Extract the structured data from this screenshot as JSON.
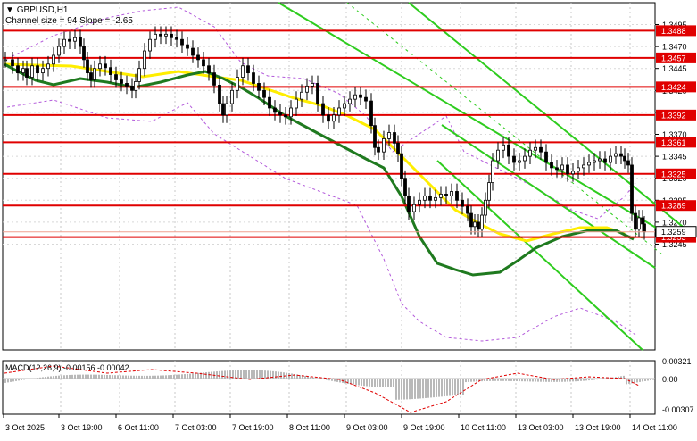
{
  "header": {
    "symbol": "GBPUSD,H1",
    "channel": "Channel size = 94 Slope = -2.65"
  },
  "price_axis": {
    "ticks": [
      "1.3495",
      "1.3470",
      "1.3445",
      "1.3420",
      "1.3395",
      "1.3370",
      "1.3345",
      "1.3320",
      "1.3295",
      "1.3270",
      "1.3245"
    ]
  },
  "levels": [
    {
      "label": "1.3488",
      "price": 1.3488
    },
    {
      "label": "1.3457",
      "price": 1.3457
    },
    {
      "label": "1.3424",
      "price": 1.3424
    },
    {
      "label": "1.3392",
      "price": 1.3392
    },
    {
      "label": "1.3361",
      "price": 1.3361
    },
    {
      "label": "1.3325",
      "price": 1.3325
    },
    {
      "label": "1.3289",
      "price": 1.3289
    },
    {
      "label": "1.3253",
      "price": 1.3253
    }
  ],
  "current_price": {
    "label": "1.3259",
    "price": 1.3259
  },
  "macd": {
    "title": "MACD(12,26,9) -0.00156 -0.00042",
    "ticks": [
      "0.00321",
      "0.00",
      "-0.00307"
    ]
  },
  "time_axis": {
    "labels": [
      "3 Oct 2025",
      "3 Oct 19:00",
      "6 Oct 11:00",
      "7 Oct 03:00",
      "7 Oct 19:00",
      "8 Oct 11:00",
      "9 Oct 03:00",
      "9 Oct 19:00",
      "10 Oct 11:00",
      "13 Oct 03:00",
      "13 Oct 19:00",
      "14 Oct 11:00"
    ]
  },
  "chart_data": {
    "type": "candlestick",
    "symbol": "GBPUSD",
    "timeframe": "H1",
    "ylim": [
      1.3235,
      1.3502
    ],
    "close_path": [
      [
        0,
        1.3455
      ],
      [
        8,
        1.3448
      ],
      [
        14,
        1.344
      ],
      [
        20,
        1.3445
      ],
      [
        24,
        1.3435
      ],
      [
        30,
        1.3448
      ],
      [
        36,
        1.344
      ],
      [
        42,
        1.3445
      ],
      [
        48,
        1.345
      ],
      [
        54,
        1.346
      ],
      [
        60,
        1.347
      ],
      [
        66,
        1.3478
      ],
      [
        72,
        1.3476
      ],
      [
        78,
        1.348
      ],
      [
        84,
        1.347
      ],
      [
        88,
        1.3455
      ],
      [
        92,
        1.344
      ],
      [
        96,
        1.3432
      ],
      [
        100,
        1.3445
      ],
      [
        106,
        1.345
      ],
      [
        112,
        1.3446
      ],
      [
        118,
        1.3438
      ],
      [
        124,
        1.3432
      ],
      [
        130,
        1.3428
      ],
      [
        136,
        1.3425
      ],
      [
        142,
        1.342
      ],
      [
        146,
        1.343
      ],
      [
        150,
        1.3445
      ],
      [
        156,
        1.3465
      ],
      [
        162,
        1.3478
      ],
      [
        168,
        1.3484
      ],
      [
        174,
        1.3482
      ],
      [
        180,
        1.3484
      ],
      [
        186,
        1.348
      ],
      [
        192,
        1.3478
      ],
      [
        198,
        1.3472
      ],
      [
        204,
        1.3468
      ],
      [
        210,
        1.346
      ],
      [
        216,
        1.3455
      ],
      [
        222,
        1.3448
      ],
      [
        228,
        1.344
      ],
      [
        234,
        1.3426
      ],
      [
        240,
        1.3405
      ],
      [
        244,
        1.3392
      ],
      [
        248,
        1.3405
      ],
      [
        254,
        1.342
      ],
      [
        260,
        1.3435
      ],
      [
        266,
        1.3448
      ],
      [
        272,
        1.344
      ],
      [
        278,
        1.3428
      ],
      [
        284,
        1.342
      ],
      [
        290,
        1.3412
      ],
      [
        296,
        1.34
      ],
      [
        302,
        1.3395
      ],
      [
        308,
        1.3392
      ],
      [
        314,
        1.339
      ],
      [
        320,
        1.34
      ],
      [
        326,
        1.341
      ],
      [
        332,
        1.3418
      ],
      [
        338,
        1.3425
      ],
      [
        344,
        1.3428
      ],
      [
        350,
        1.3405
      ],
      [
        356,
        1.3392
      ],
      [
        362,
        1.3385
      ],
      [
        368,
        1.3392
      ],
      [
        374,
        1.34
      ],
      [
        380,
        1.3405
      ],
      [
        386,
        1.341
      ],
      [
        392,
        1.3415
      ],
      [
        398,
        1.3412
      ],
      [
        404,
        1.3408
      ],
      [
        410,
        1.338
      ],
      [
        414,
        1.3355
      ],
      [
        418,
        1.335
      ],
      [
        424,
        1.3365
      ],
      [
        430,
        1.3372
      ],
      [
        436,
        1.336
      ],
      [
        440,
        1.3348
      ],
      [
        444,
        1.332
      ],
      [
        448,
        1.33
      ],
      [
        452,
        1.3282
      ],
      [
        458,
        1.329
      ],
      [
        464,
        1.3295
      ],
      [
        470,
        1.33
      ],
      [
        476,
        1.3295
      ],
      [
        482,
        1.3298
      ],
      [
        488,
        1.3302
      ],
      [
        494,
        1.33
      ],
      [
        500,
        1.3305
      ],
      [
        506,
        1.3295
      ],
      [
        512,
        1.3288
      ],
      [
        518,
        1.328
      ],
      [
        522,
        1.3265
      ],
      [
        526,
        1.327
      ],
      [
        530,
        1.3262
      ],
      [
        534,
        1.3278
      ],
      [
        538,
        1.3295
      ],
      [
        542,
        1.3315
      ],
      [
        546,
        1.334
      ],
      [
        552,
        1.3352
      ],
      [
        558,
        1.3358
      ],
      [
        564,
        1.3345
      ],
      [
        570,
        1.3338
      ],
      [
        576,
        1.334
      ],
      [
        582,
        1.3345
      ],
      [
        588,
        1.3352
      ],
      [
        594,
        1.3355
      ],
      [
        600,
        1.335
      ],
      [
        606,
        1.3338
      ],
      [
        612,
        1.3332
      ],
      [
        618,
        1.333
      ],
      [
        624,
        1.3335
      ],
      [
        630,
        1.3325
      ],
      [
        636,
        1.3328
      ],
      [
        642,
        1.3332
      ],
      [
        648,
        1.3335
      ],
      [
        654,
        1.3338
      ],
      [
        660,
        1.334
      ],
      [
        666,
        1.3342
      ],
      [
        672,
        1.3338
      ],
      [
        678,
        1.3345
      ],
      [
        684,
        1.3348
      ],
      [
        690,
        1.3345
      ],
      [
        694,
        1.334
      ],
      [
        698,
        1.3335
      ],
      [
        702,
        1.328
      ],
      [
        706,
        1.3262
      ],
      [
        710,
        1.3275
      ],
      [
        714,
        1.3268
      ],
      [
        716,
        1.3259
      ]
    ]
  }
}
